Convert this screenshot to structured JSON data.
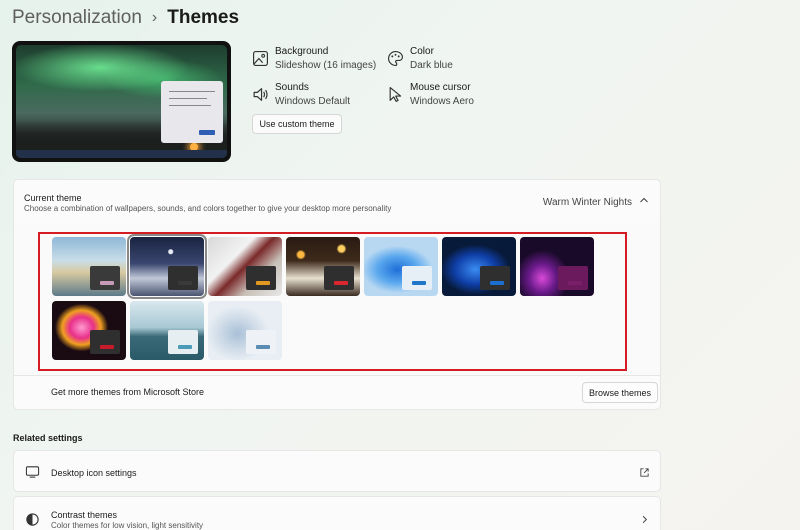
{
  "breadcrumb": {
    "parent": "Personalization",
    "separator": "›",
    "current": "Themes"
  },
  "properties": {
    "background": {
      "title": "Background",
      "value": "Slideshow (16 images)",
      "icon": "picture-icon"
    },
    "color": {
      "title": "Color",
      "value": "Dark blue",
      "icon": "palette-icon"
    },
    "sounds": {
      "title": "Sounds",
      "value": "Windows Default",
      "icon": "speaker-icon"
    },
    "mouse_cursor": {
      "title": "Mouse cursor",
      "value": "Windows Aero",
      "icon": "cursor-icon"
    }
  },
  "custom_theme_button": "Use custom theme",
  "current_theme": {
    "title": "Current theme",
    "description": "Choose a combination of wallpapers, sounds, and colors together to give your desktop more personality",
    "value": "Warm Winter Nights",
    "themes": [
      {
        "id": "theme-1",
        "accent": "#c79ab8",
        "window": "#3a3a3a",
        "selected": false
      },
      {
        "id": "theme-2",
        "accent": "#3a3a3a",
        "window": "#2f2f2f",
        "selected": true
      },
      {
        "id": "theme-3",
        "accent": "#e39822",
        "window": "#2f2f2f",
        "selected": false
      },
      {
        "id": "theme-4",
        "accent": "#d9262f",
        "window": "#2f2f2f",
        "selected": false
      },
      {
        "id": "theme-5",
        "accent": "#1f77c9",
        "window": "#e6eef6",
        "selected": false
      },
      {
        "id": "theme-6",
        "accent": "#1a6fd1",
        "window": "#2f2f2f",
        "selected": false
      },
      {
        "id": "theme-7",
        "accent": "#7a1e6a",
        "window": "#6b1a5e",
        "selected": false
      },
      {
        "id": "theme-8",
        "accent": "#c71a2a",
        "window": "#2f2f2f",
        "selected": false
      },
      {
        "id": "theme-9",
        "accent": "#4b9ab8",
        "window": "#e6eef2",
        "selected": false
      },
      {
        "id": "theme-10",
        "accent": "#5a8bb0",
        "window": "#eef2f6",
        "selected": false
      }
    ]
  },
  "store": {
    "label": "Get more themes from Microsoft Store",
    "button": "Browse themes"
  },
  "related_settings": {
    "title": "Related settings",
    "desktop_icons": {
      "label": "Desktop icon settings"
    },
    "contrast": {
      "label": "Contrast themes",
      "sub": "Color themes for low vision, light sensitivity"
    }
  },
  "colors": {
    "highlight": "#d41c22",
    "accent": "#2f5fb5"
  }
}
